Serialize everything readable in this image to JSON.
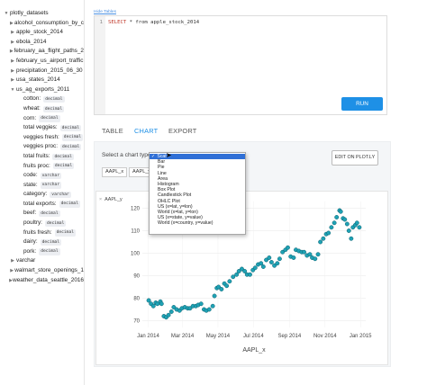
{
  "sidebar": {
    "root": "plotly_datasets",
    "items_before": [
      "alcohol_consumption_by_c",
      "apple_stock_2014",
      "ebola_2014",
      "february_aa_flight_paths_2",
      "february_us_airport_traffic",
      "precipitation_2015_06_30",
      "usa_states_2014"
    ],
    "expanded": "us_ag_exports_2011",
    "columns": [
      {
        "name": "cotton:",
        "type": "decimal"
      },
      {
        "name": "wheat:",
        "type": "decimal"
      },
      {
        "name": "corn:",
        "type": "decimal"
      },
      {
        "name": "total veggies:",
        "type": "decimal"
      },
      {
        "name": "veggies fresh:",
        "type": "decimal"
      },
      {
        "name": "veggies proc:",
        "type": "decimal"
      },
      {
        "name": "total fruits:",
        "type": "decimal"
      },
      {
        "name": "fruits proc:",
        "type": "decimal"
      },
      {
        "name": "code:",
        "type": "varchar"
      },
      {
        "name": "state:",
        "type": "varchar"
      },
      {
        "name": "category:",
        "type": "varchar"
      },
      {
        "name": "total exports:",
        "type": "decimal"
      },
      {
        "name": "beef:",
        "type": "decimal"
      },
      {
        "name": "poultry:",
        "type": "decimal"
      },
      {
        "name": "fruits fresh:",
        "type": "decimal"
      },
      {
        "name": "dairy:",
        "type": "decimal"
      },
      {
        "name": "pork:",
        "type": "decimal"
      }
    ],
    "items_after": [
      "varchar",
      "walmart_store_openings_1",
      "weather_data_seattle_2016"
    ]
  },
  "editor": {
    "hide_link": "Hide Tables",
    "line_number": "1",
    "sql_keyword_1": "SELECT",
    "sql_star": " * ",
    "sql_keyword_2": "from",
    "sql_table": " apple_stock_2014"
  },
  "run_label": "RUN",
  "tabs": {
    "table": "TABLE",
    "chart": "CHART",
    "export": "EXPORT"
  },
  "chart_panel": {
    "type_label": "Select a chart type",
    "edit_button": "EDIT ON PLOT.LY",
    "x_chip": "AAPL_x",
    "y_chip": "AAPL_y",
    "legend_close": "×",
    "legend": "AAPL_y"
  },
  "dropdown": {
    "options": [
      "Scatter",
      "Bar",
      "Pie",
      "Line",
      "Area",
      "Histogram",
      "Box Plot",
      "Candlestick Plot",
      "OHLC Plot",
      "US (x=lat, y=lon)",
      "World (x=lat, y=lon)",
      "US (x=state, y=value)",
      "World (x=country, y=value)"
    ],
    "selected_index": 0,
    "selected_display": "Scat"
  },
  "colors": {
    "accent": "#1e90e6",
    "marker": "#1fa2b5",
    "marker_edge": "#0b5f6d",
    "selected": "#2f6fd6"
  },
  "chart_data": {
    "type": "scatter",
    "xlabel": "AAPL_x",
    "ylabel": "",
    "x_tick_labels": [
      "Jan 2014",
      "Mar 2014",
      "May 2014",
      "Jul 2014",
      "Sep 2014",
      "Nov 2014",
      "Jan 2015"
    ],
    "y_ticks": [
      70,
      80,
      90,
      100,
      110,
      120
    ],
    "ylim": [
      67,
      123
    ],
    "xlim": [
      "2013-12-22",
      "2015-01-10"
    ],
    "series": [
      {
        "name": "AAPL_y",
        "points": [
          [
            "2014-01-02",
            79.0
          ],
          [
            "2014-01-06",
            77.5
          ],
          [
            "2014-01-10",
            76.5
          ],
          [
            "2014-01-14",
            78.0
          ],
          [
            "2014-01-17",
            77.5
          ],
          [
            "2014-01-22",
            78.5
          ],
          [
            "2014-01-24",
            77.5
          ],
          [
            "2014-01-28",
            72.0
          ],
          [
            "2014-02-01",
            71.5
          ],
          [
            "2014-02-05",
            72.5
          ],
          [
            "2014-02-10",
            74.0
          ],
          [
            "2014-02-14",
            76.0
          ],
          [
            "2014-02-19",
            75.0
          ],
          [
            "2014-02-24",
            74.5
          ],
          [
            "2014-02-28",
            75.5
          ],
          [
            "2014-03-05",
            76.0
          ],
          [
            "2014-03-10",
            75.5
          ],
          [
            "2014-03-14",
            75.5
          ],
          [
            "2014-03-19",
            76.5
          ],
          [
            "2014-03-24",
            76.5
          ],
          [
            "2014-03-28",
            77.0
          ],
          [
            "2014-04-02",
            77.5
          ],
          [
            "2014-04-07",
            75.0
          ],
          [
            "2014-04-11",
            74.5
          ],
          [
            "2014-04-16",
            75.0
          ],
          [
            "2014-04-22",
            76.5
          ],
          [
            "2014-04-25",
            81.0
          ],
          [
            "2014-04-29",
            84.5
          ],
          [
            "2014-05-02",
            85.0
          ],
          [
            "2014-05-07",
            84.0
          ],
          [
            "2014-05-12",
            86.5
          ],
          [
            "2014-05-16",
            85.5
          ],
          [
            "2014-05-21",
            87.5
          ],
          [
            "2014-05-27",
            89.5
          ],
          [
            "2014-06-02",
            90.5
          ],
          [
            "2014-06-06",
            92.0
          ],
          [
            "2014-06-11",
            93.0
          ],
          [
            "2014-06-16",
            92.0
          ],
          [
            "2014-06-20",
            90.5
          ],
          [
            "2014-06-25",
            90.5
          ],
          [
            "2014-06-30",
            92.5
          ],
          [
            "2014-07-04",
            93.5
          ],
          [
            "2014-07-09",
            95.0
          ],
          [
            "2014-07-14",
            95.5
          ],
          [
            "2014-07-18",
            94.0
          ],
          [
            "2014-07-23",
            97.0
          ],
          [
            "2014-07-28",
            98.0
          ],
          [
            "2014-08-01",
            96.0
          ],
          [
            "2014-08-06",
            94.5
          ],
          [
            "2014-08-11",
            95.5
          ],
          [
            "2014-08-15",
            97.5
          ],
          [
            "2014-08-20",
            100.5
          ],
          [
            "2014-08-25",
            101.5
          ],
          [
            "2014-08-29",
            102.5
          ],
          [
            "2014-09-03",
            98.5
          ],
          [
            "2014-09-08",
            98.0
          ],
          [
            "2014-09-12",
            101.5
          ],
          [
            "2014-09-17",
            101.0
          ],
          [
            "2014-09-22",
            100.5
          ],
          [
            "2014-09-26",
            100.5
          ],
          [
            "2014-10-01",
            99.0
          ],
          [
            "2014-10-06",
            99.5
          ],
          [
            "2014-10-10",
            98.0
          ],
          [
            "2014-10-15",
            97.5
          ],
          [
            "2014-10-20",
            99.5
          ],
          [
            "2014-10-24",
            105.0
          ],
          [
            "2014-10-29",
            106.5
          ],
          [
            "2014-11-03",
            108.5
          ],
          [
            "2014-11-07",
            109.0
          ],
          [
            "2014-11-12",
            111.5
          ],
          [
            "2014-11-17",
            113.5
          ],
          [
            "2014-11-21",
            116.0
          ],
          [
            "2014-11-26",
            119.0
          ],
          [
            "2014-11-28",
            118.5
          ],
          [
            "2014-12-02",
            115.5
          ],
          [
            "2014-12-05",
            115.0
          ],
          [
            "2014-12-09",
            113.0
          ],
          [
            "2014-12-12",
            110.0
          ],
          [
            "2014-12-16",
            106.5
          ],
          [
            "2014-12-19",
            111.5
          ],
          [
            "2014-12-23",
            112.5
          ],
          [
            "2014-12-26",
            113.5
          ],
          [
            "2014-12-30",
            111.5
          ]
        ]
      }
    ]
  }
}
